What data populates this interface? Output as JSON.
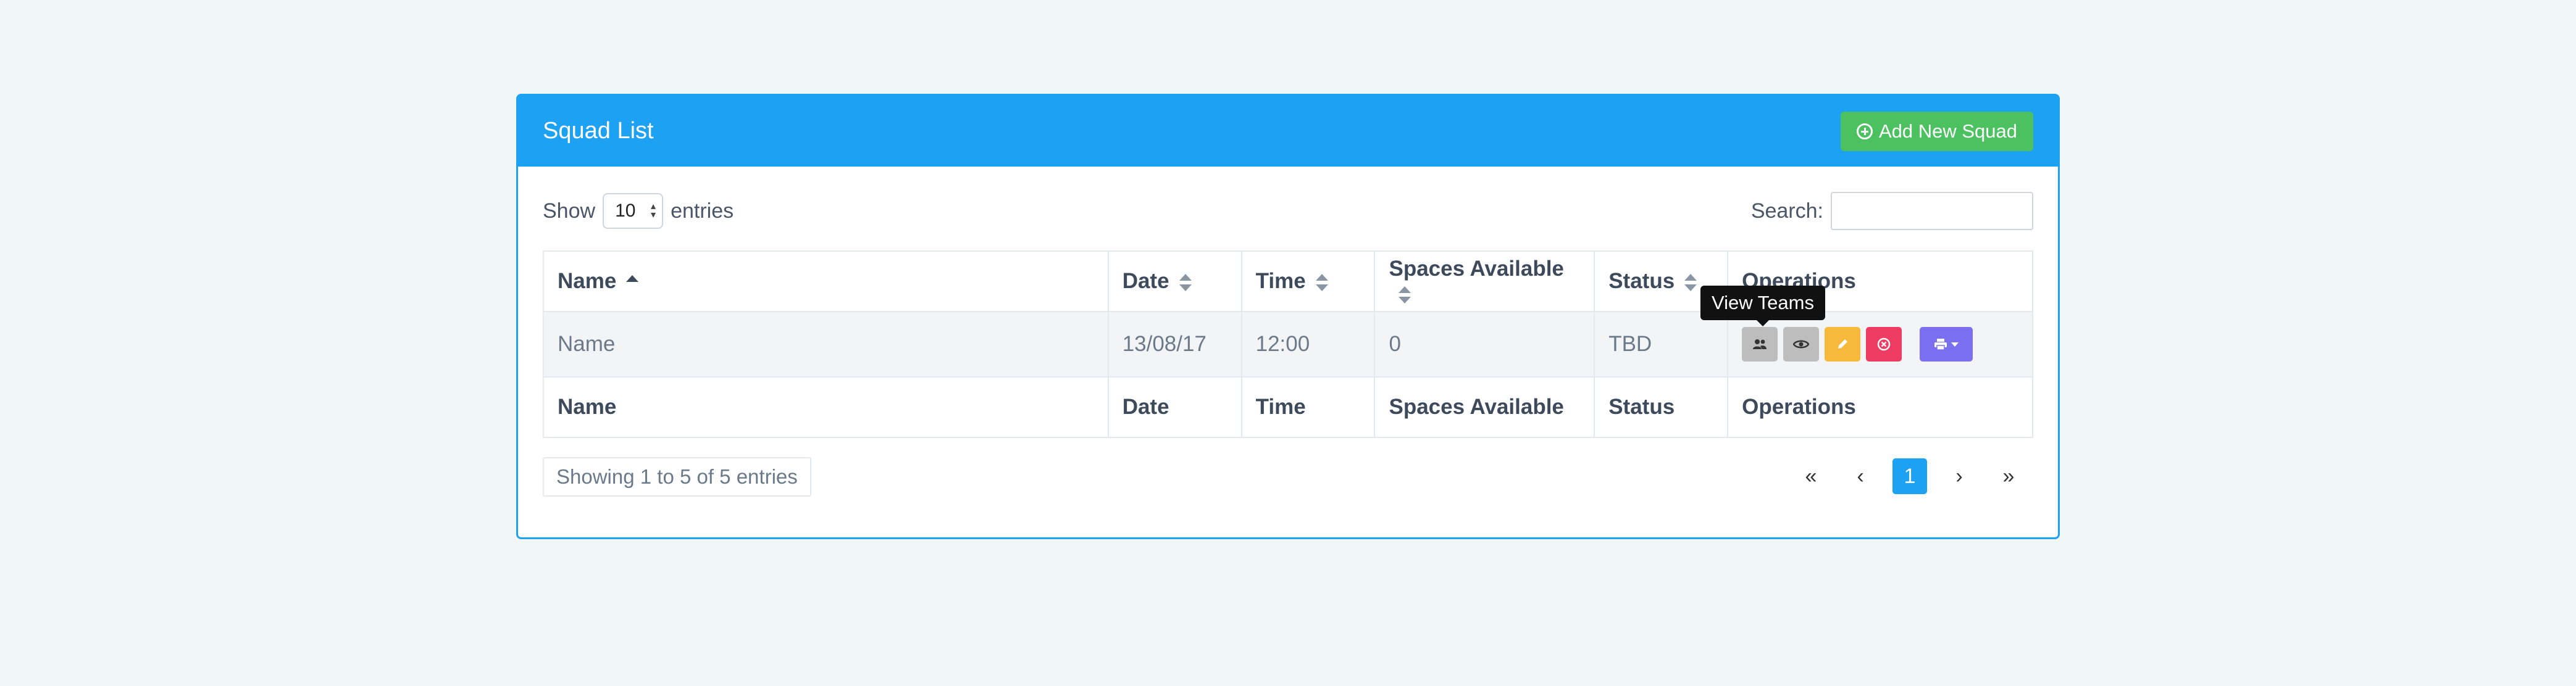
{
  "header": {
    "title": "Squad List",
    "add_button_label": "Add New Squad"
  },
  "controls": {
    "show_label": "Show",
    "length_value": "10",
    "entries_label": "entries",
    "search_label": "Search:",
    "search_value": ""
  },
  "table": {
    "columns": [
      "Name",
      "Date",
      "Time",
      "Spaces Available",
      "Status",
      "Operations"
    ],
    "sorted_column": "Name",
    "rows": [
      {
        "name": "Name",
        "date": "13/08/17",
        "time": "12:00",
        "spaces": "0",
        "status": "TBD"
      }
    ],
    "footer_columns": [
      "Name",
      "Date",
      "Time",
      "Spaces Available",
      "Status",
      "Operations"
    ]
  },
  "operations": {
    "teams_icon": "people-icon",
    "view_icon": "eye-icon",
    "edit_icon": "pencil-icon",
    "delete_icon": "close-circle-icon",
    "print_icon": "printer-icon"
  },
  "tooltip": {
    "text": "View Teams"
  },
  "info": {
    "text": "Showing 1 to 5 of 5 entries"
  },
  "pagination": {
    "first": "«",
    "prev": "‹",
    "current": "1",
    "next": "›",
    "last": "»"
  },
  "colors": {
    "primary": "#1da1f2",
    "success": "#4cc160",
    "warning": "#f6b93b",
    "danger": "#ee3b62",
    "purple": "#7a6ff0",
    "neutral": "#bdbdbd"
  }
}
